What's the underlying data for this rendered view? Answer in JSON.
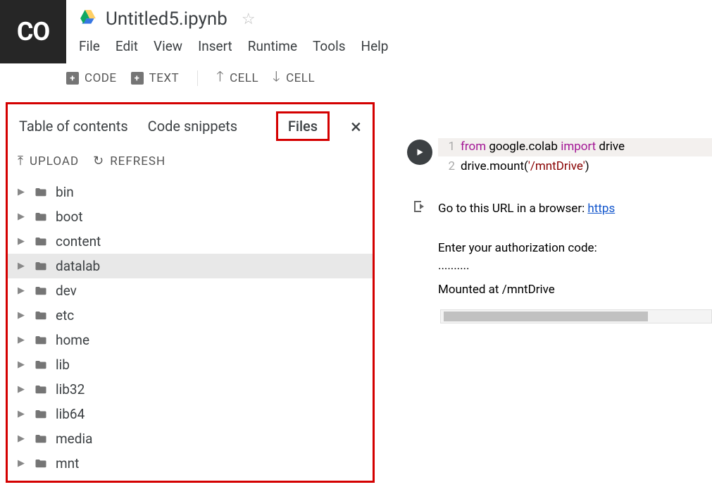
{
  "logo": {
    "text": "CO"
  },
  "doc": {
    "title": "Untitled5.ipynb"
  },
  "menus": {
    "file": "File",
    "edit": "Edit",
    "view": "View",
    "insert": "Insert",
    "runtime": "Runtime",
    "tools": "Tools",
    "help": "Help"
  },
  "toolbar": {
    "code": "CODE",
    "text": "TEXT",
    "cell_up": "CELL",
    "cell_down": "CELL"
  },
  "sidebar": {
    "tabs": {
      "toc": "Table of contents",
      "snippets": "Code snippets",
      "files": "Files"
    },
    "actions": {
      "upload": "UPLOAD",
      "refresh": "REFRESH"
    },
    "tree": [
      {
        "name": "bin",
        "selected": false
      },
      {
        "name": "boot",
        "selected": false
      },
      {
        "name": "content",
        "selected": false
      },
      {
        "name": "datalab",
        "selected": true
      },
      {
        "name": "dev",
        "selected": false
      },
      {
        "name": "etc",
        "selected": false
      },
      {
        "name": "home",
        "selected": false
      },
      {
        "name": "lib",
        "selected": false
      },
      {
        "name": "lib32",
        "selected": false
      },
      {
        "name": "lib64",
        "selected": false
      },
      {
        "name": "media",
        "selected": false
      },
      {
        "name": "mnt",
        "selected": false
      }
    ]
  },
  "cell": {
    "code": {
      "l1_from": "from",
      "l1_mod": " google.colab ",
      "l1_import": "import",
      "l1_rest": " drive",
      "l2_pre": "drive.mount(",
      "l2_str": "'/mntDrive'",
      "l2_post": ")"
    },
    "output": {
      "line1_pre": "Go to this URL in a browser: ",
      "line1_link": "https",
      "line2": "Enter your authorization code:",
      "line3": "··········",
      "line4": "Mounted at /mntDrive"
    }
  }
}
